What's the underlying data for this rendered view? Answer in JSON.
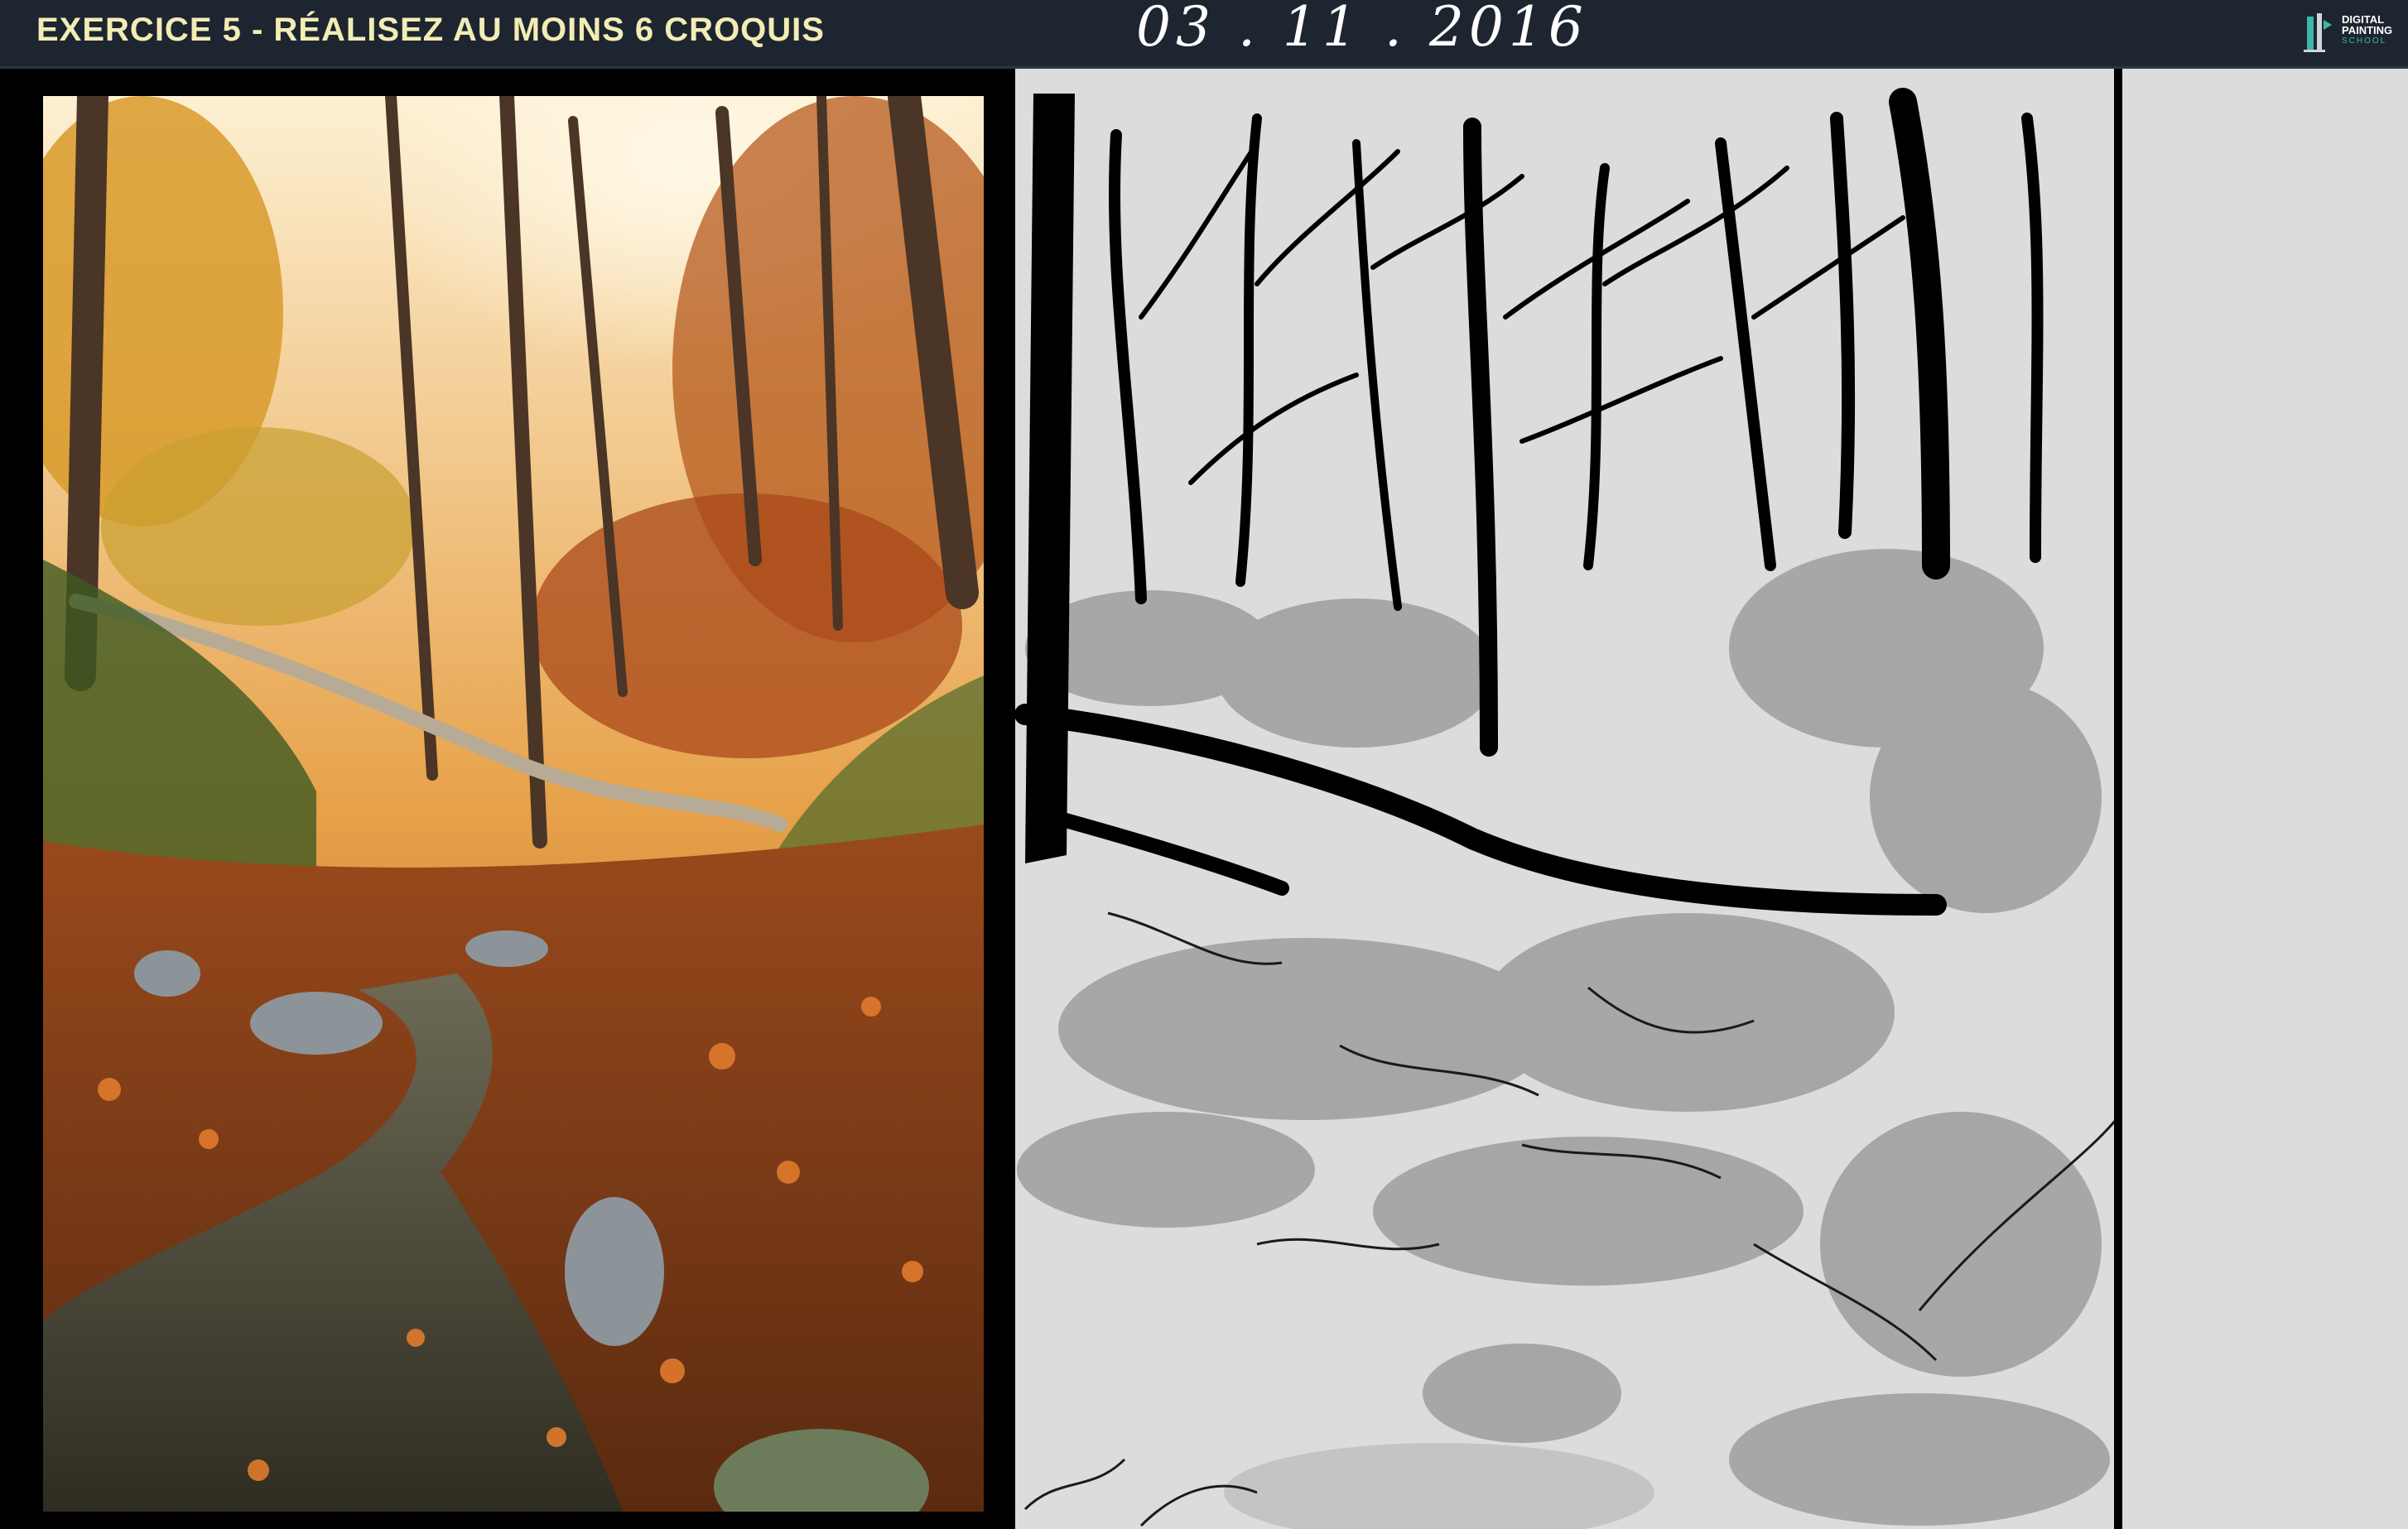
{
  "header": {
    "title": "EXERCICE 5 - RÉALISEZ AU MOINS 6 CROQUIS",
    "date": "03 . 11 . 2016"
  },
  "logo": {
    "line1": "DIGITAL",
    "line2": "PAINTING",
    "line3": "SCHOOL",
    "accent_color": "#3fb8a8"
  },
  "colors": {
    "header_bg": "#1d2530",
    "title_color": "#f3ecb4",
    "canvas_bg": "#dcdcdc"
  }
}
